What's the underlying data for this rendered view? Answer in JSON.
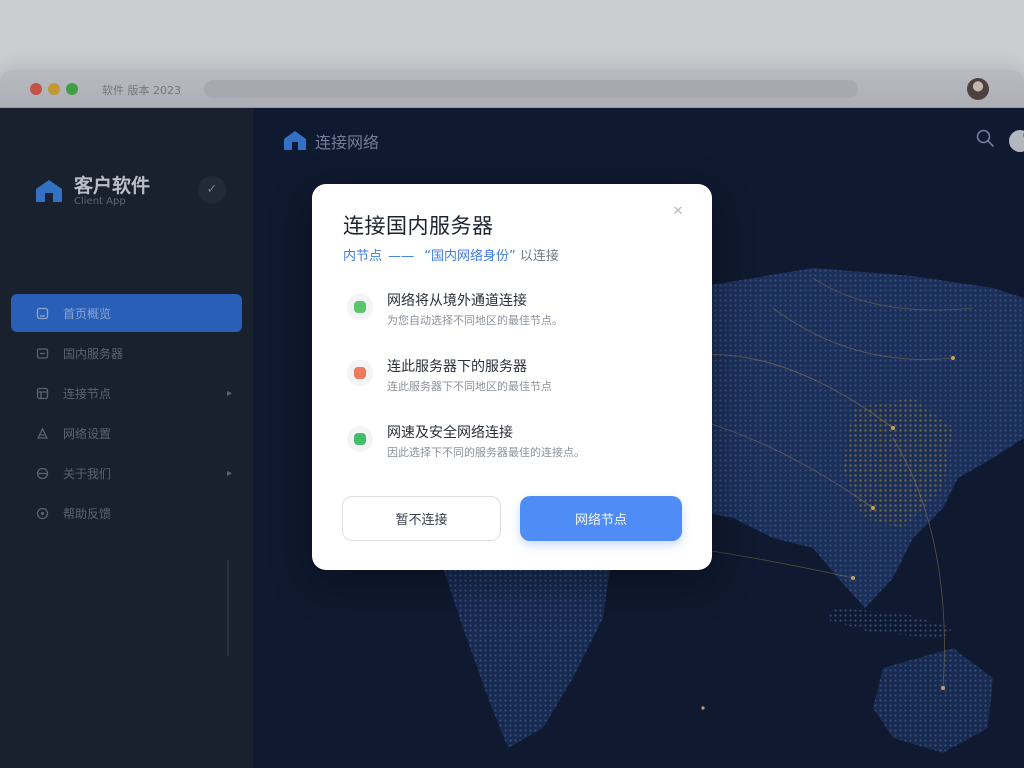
{
  "window": {
    "title": "软件 版本 2023"
  },
  "sidebar": {
    "brand_name": "客户软件",
    "brand_sub": "Client App",
    "items": [
      {
        "label": "首页概览",
        "icon": "home-icon",
        "active": true
      },
      {
        "label": "国内服务器",
        "icon": "server-icon",
        "active": false
      },
      {
        "label": "连接节点",
        "icon": "node-icon",
        "active": false,
        "has_chevron": true
      },
      {
        "label": "网络设置",
        "icon": "settings-icon",
        "active": false
      },
      {
        "label": "关于我们",
        "icon": "globe-icon",
        "active": false,
        "has_chevron": true
      },
      {
        "label": "帮助反馈",
        "icon": "help-icon",
        "active": false
      }
    ]
  },
  "main": {
    "title": "连接网络"
  },
  "modal": {
    "title": "连接国内服务器",
    "subtitle_lead": "内节点",
    "subtitle_dash": "——",
    "subtitle_quote": "“国内网络身份”",
    "subtitle_tail": "以连接",
    "options": [
      {
        "title": "网络将从境外通道连接",
        "desc": "为您自动选择不同地区的最佳节点。",
        "color": "#5cc46a"
      },
      {
        "title": "连此服务器下的服务器",
        "desc": "连此服务器下不同地区的最佳节点",
        "color": "#ef7a5e"
      },
      {
        "title": "网速及安全网络连接",
        "desc": "因此选择下不同的服务器最佳的连接点。",
        "color": "#42bd6c"
      }
    ],
    "cancel_label": "暂不连接",
    "confirm_label": "网络节点"
  },
  "colors": {
    "accent": "#4f8cf6",
    "sidebar_bg": "#1d2431",
    "main_bg": "#0f1a33"
  }
}
